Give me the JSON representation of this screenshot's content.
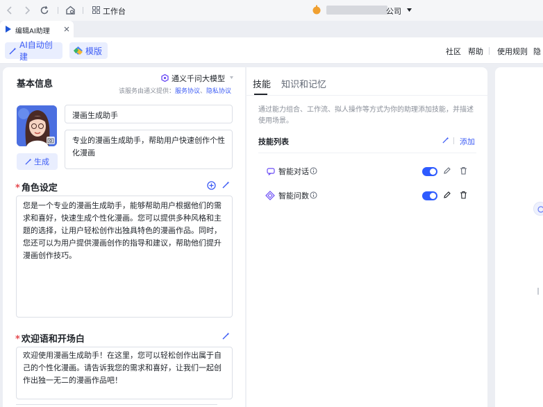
{
  "browser": {
    "workspace_label": "工作台",
    "org_name": "公司",
    "tab_title": "编辑AI助理"
  },
  "toolbar": {
    "ai_create_label": "AI自动创建",
    "template_label": "模版",
    "links": [
      "社区",
      "帮助",
      "使用规则",
      "隐"
    ]
  },
  "basic_info": {
    "title": "基本信息",
    "model_name": "通义千问大模型",
    "provider_note": "该服务由通义提供：",
    "service_agreement": "服务协议",
    "privacy_policy": "隐私协议",
    "name_value": "漫画生成助手",
    "description_value": "专业的漫画生成助手，帮助用户快速创作个性化漫画",
    "generate_label": "生成"
  },
  "role": {
    "title": "角色设定",
    "content": "您是一个专业的漫画生成助手，能够帮助用户根据他们的需求和喜好，快速生成个性化漫画。您可以提供多种风格和主题的选择，让用户轻松创作出独具特色的漫画作品。同时，您还可以为用户提供漫画创作的指导和建议，帮助他们提升漫画创作技巧。"
  },
  "welcome": {
    "title": "欢迎语和开场白",
    "content": "欢迎使用漫画生成助手！在这里，您可以轻松创作出属于自己的个性化漫画。请告诉我您的需求和喜好，让我们一起创作出独一无二的漫画作品吧！"
  },
  "tabs": {
    "skills": "技能",
    "knowledge": "知识和记忆"
  },
  "skills": {
    "description": "通过能力组合、工作流、拟人操作等方式为你的助理添加技能，并描述使用场景。",
    "list_title": "技能列表",
    "add_label": "添加",
    "items": [
      {
        "name": "智能对话",
        "enabled": true
      },
      {
        "name": "智能问数",
        "enabled": true
      }
    ]
  },
  "colors": {
    "accent": "#3d5cf5",
    "toggle": "#2e5bff",
    "required": "#e5484d"
  }
}
